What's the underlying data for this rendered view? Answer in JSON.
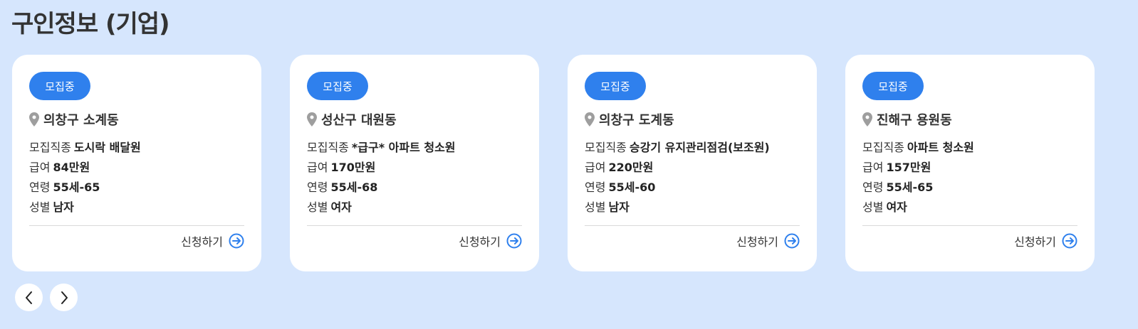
{
  "section": {
    "title": "구인정보 (기업)"
  },
  "labels": {
    "job_type": "모집직종",
    "salary": "급여",
    "age": "연령",
    "gender": "성별",
    "apply": "신청하기"
  },
  "cards": [
    {
      "status": "모집중",
      "location": "의창구 소계동",
      "job": "도시락 배달원",
      "salary": "84만원",
      "age": "55세-65",
      "gender": "남자"
    },
    {
      "status": "모집중",
      "location": "성산구 대원동",
      "job": "*급구* 아파트 청소원",
      "salary": "170만원",
      "age": "55세-68",
      "gender": "여자"
    },
    {
      "status": "모집중",
      "location": "의창구 도계동",
      "job": "승강기 유지관리점검(보조원)",
      "salary": "220만원",
      "age": "55세-60",
      "gender": "남자"
    },
    {
      "status": "모집중",
      "location": "진해구 용원동",
      "job": "아파트 청소원",
      "salary": "157만원",
      "age": "55세-65",
      "gender": "여자"
    }
  ],
  "colors": {
    "background": "#d6e6fd",
    "accent": "#2f80ed",
    "card": "#ffffff",
    "pin": "#9e9e9e"
  },
  "icons": {
    "location": "map-pin-icon",
    "apply": "arrow-right-circle-icon",
    "prev": "chevron-left-icon",
    "next": "chevron-right-icon"
  }
}
